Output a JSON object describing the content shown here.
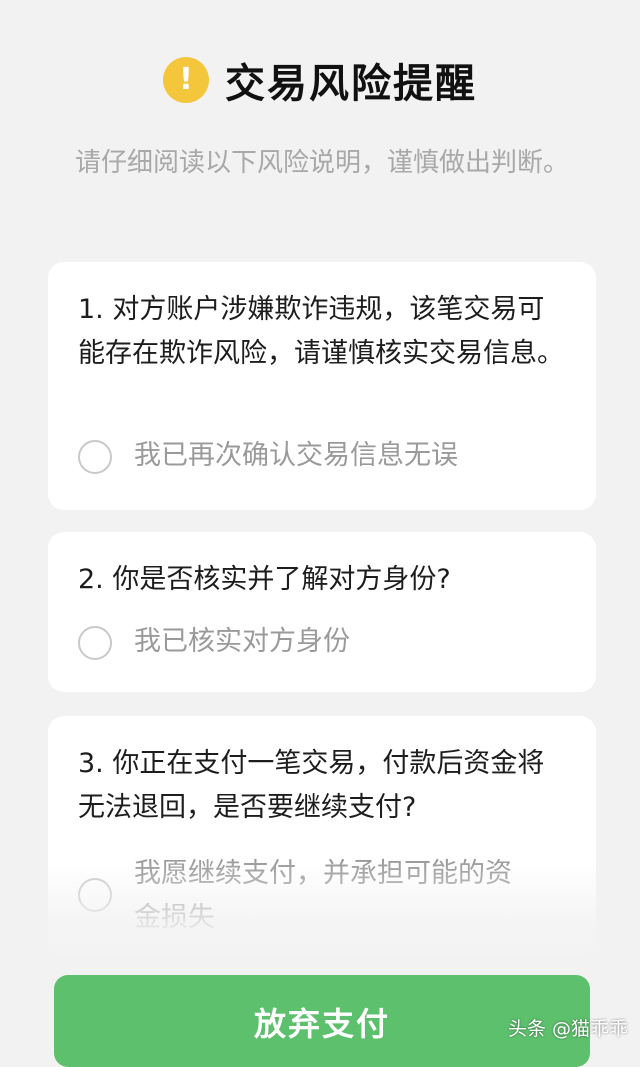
{
  "header": {
    "icon_glyph": "!",
    "icon_name": "warning-icon",
    "icon_color": "#f4c63b",
    "title": "交易风险提醒"
  },
  "subtitle": "请仔细阅读以下风险说明，谨慎做出判断。",
  "questions": [
    {
      "text": "1. 对方账户涉嫌欺诈违规，该笔交易可能存在欺诈风险，请谨慎核实交易信息。",
      "option": "我已再次确认交易信息无误",
      "checked": false
    },
    {
      "text": "2. 你是否核实并了解对方身份?",
      "option": "我已核实对方身份",
      "checked": false
    },
    {
      "text": "3. 你正在支付一笔交易，付款后资金将无法退回，是否要继续支付?",
      "option": "我愿继续支付，并承担可能的资金损失",
      "checked": false
    }
  ],
  "footer": {
    "abandon_label": "放弃支付",
    "accent_color": "#5dc06c"
  },
  "watermark": "头条 @猫乖乖"
}
